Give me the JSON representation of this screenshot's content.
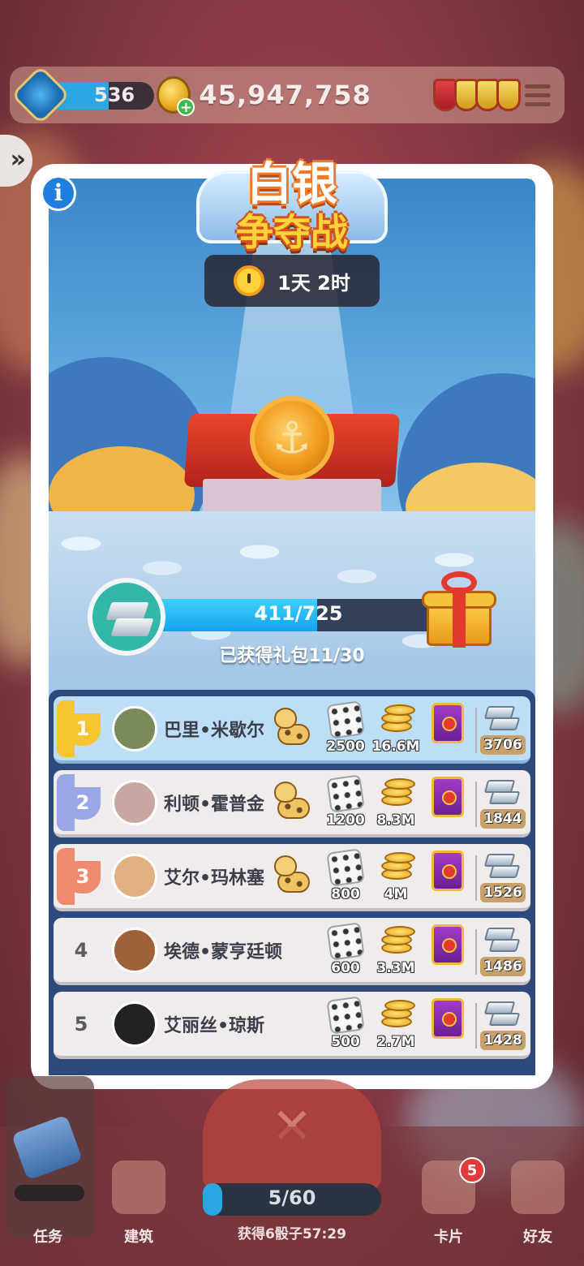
{
  "topbar": {
    "level": "536",
    "level_progress": 0.6,
    "coins": "45,947,758"
  },
  "event": {
    "title_line1": "白银",
    "title_line2": "争夺战",
    "timer": "1天 2时",
    "progress_text": "411/725",
    "progress_fraction": 0.567,
    "packs_text": "已获得礼包11/30"
  },
  "leaderboard": [
    {
      "rank": "1",
      "name": "巴里•米歇尔",
      "dice": "2500",
      "coins": "16.6M",
      "silver": "3706",
      "highlight": true,
      "cat": true
    },
    {
      "rank": "2",
      "name": "利顿•霍普金",
      "dice": "1200",
      "coins": "8.3M",
      "silver": "1844",
      "highlight": false,
      "cat": true
    },
    {
      "rank": "3",
      "name": "艾尔•玛林塞",
      "dice": "800",
      "coins": "4M",
      "silver": "1526",
      "highlight": false,
      "cat": true
    },
    {
      "rank": "4",
      "name": "埃德•蒙亨廷顿",
      "dice": "600",
      "coins": "3.3M",
      "silver": "1486",
      "highlight": false,
      "cat": false
    },
    {
      "rank": "5",
      "name": "艾丽丝•琼斯",
      "dice": "500",
      "coins": "2.7M",
      "silver": "1428",
      "highlight": false,
      "cat": false
    }
  ],
  "bottom_nav": {
    "tasks": "任务",
    "build": "建筑",
    "dice_count": "5/60",
    "dice_progress": 0.083,
    "dice_timer": "获得6骰子57:29",
    "cards": "卡片",
    "cards_badge": "5",
    "friends": "好友"
  },
  "colors": {
    "rank1": "#f6c531",
    "rank2": "#9aa6e8",
    "rank3": "#ef8a6e",
    "accent_blue": "#2aa6e0"
  }
}
